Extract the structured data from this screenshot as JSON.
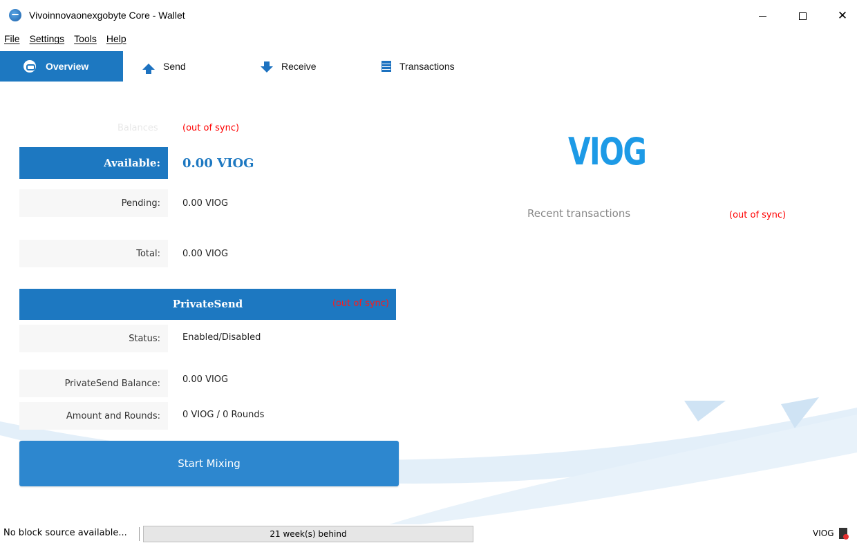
{
  "window": {
    "title": "Vivoinnovaonexgobyte Core - Wallet",
    "controls": {
      "minimize": "—",
      "maximize": "□",
      "close": "✕"
    }
  },
  "menu": [
    {
      "label": "File"
    },
    {
      "label": "Settings"
    },
    {
      "label": "Tools"
    },
    {
      "label": "Help"
    }
  ],
  "tabs": {
    "overview": "Overview",
    "send": "Send",
    "receive": "Receive",
    "transactions": "Transactions",
    "active": "overview"
  },
  "balances": {
    "header": "Balances",
    "sync_status": "(out of sync)",
    "available_label": "Available:",
    "available_value": "0.00 VIOG",
    "pending_label": "Pending:",
    "pending_value": "0.00 VIOG",
    "total_label": "Total:",
    "total_value": "0.00 VIOG"
  },
  "privatesend": {
    "title": "PrivateSend",
    "sync_status": "(out of sync)",
    "status_label": "Status:",
    "status_value": "Enabled/Disabled",
    "balance_label": "PrivateSend Balance:",
    "balance_value": "0.00 VIOG",
    "rounds_label": "Amount and Rounds:",
    "rounds_value": "0 VIOG / 0 Rounds",
    "start_button": "Start Mixing"
  },
  "right_panel": {
    "logo": "VIOG",
    "recent_label": "Recent transactions",
    "sync_status": "(out of sync)"
  },
  "statusbar": {
    "message": "No block source available...",
    "progress_text": "21 week(s) behind",
    "unit": "VIOG",
    "network_icon": "network-disconnected-icon"
  },
  "colors": {
    "accent": "#1d78c1",
    "logo": "#1d9ae6",
    "warning": "#ff0000"
  }
}
